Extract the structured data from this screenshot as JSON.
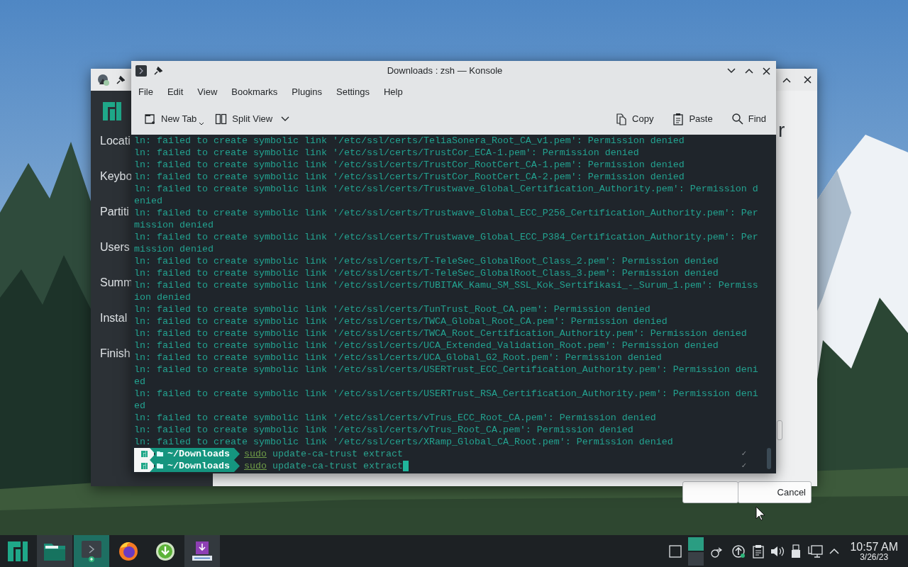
{
  "installer": {
    "sidebar_items": [
      "Locati",
      "Keybo",
      "Partiti",
      "Users",
      "Summ",
      "Instal",
      "Finish"
    ],
    "heading": "r",
    "buttons": [
      "Cancel"
    ]
  },
  "konsole": {
    "title": "Downloads : zsh — Konsole",
    "menu": [
      "File",
      "Edit",
      "View",
      "Bookmarks",
      "Plugins",
      "Settings",
      "Help"
    ],
    "toolbar_left": [
      {
        "kind": "new-tab",
        "label": "New Tab"
      },
      {
        "kind": "split-view",
        "label": "Split View"
      }
    ],
    "toolbar_right": [
      {
        "kind": "copy",
        "label": "Copy"
      },
      {
        "kind": "paste",
        "label": "Paste"
      },
      {
        "kind": "find",
        "label": "Find"
      }
    ],
    "terminal": {
      "lines": [
        "ln: failed to create symbolic link '/etc/ssl/certs/TeliaSonera_Root_CA_v1.pem': Permission denied",
        "ln: failed to create symbolic link '/etc/ssl/certs/TrustCor_ECA-1.pem': Permission denied",
        "ln: failed to create symbolic link '/etc/ssl/certs/TrustCor_RootCert_CA-1.pem': Permission denied",
        "ln: failed to create symbolic link '/etc/ssl/certs/TrustCor_RootCert_CA-2.pem': Permission denied",
        "ln: failed to create symbolic link '/etc/ssl/certs/Trustwave_Global_Certification_Authority.pem': Permission d",
        "enied",
        "ln: failed to create symbolic link '/etc/ssl/certs/Trustwave_Global_ECC_P256_Certification_Authority.pem': Per",
        "mission denied",
        "ln: failed to create symbolic link '/etc/ssl/certs/Trustwave_Global_ECC_P384_Certification_Authority.pem': Per",
        "mission denied",
        "ln: failed to create symbolic link '/etc/ssl/certs/T-TeleSec_GlobalRoot_Class_2.pem': Permission denied",
        "ln: failed to create symbolic link '/etc/ssl/certs/T-TeleSec_GlobalRoot_Class_3.pem': Permission denied",
        "ln: failed to create symbolic link '/etc/ssl/certs/TUBITAK_Kamu_SM_SSL_Kok_Sertifikasi_-_Surum_1.pem': Permiss",
        "ion denied",
        "ln: failed to create symbolic link '/etc/ssl/certs/TunTrust_Root_CA.pem': Permission denied",
        "ln: failed to create symbolic link '/etc/ssl/certs/TWCA_Global_Root_CA.pem': Permission denied",
        "ln: failed to create symbolic link '/etc/ssl/certs/TWCA_Root_Certification_Authority.pem': Permission denied",
        "ln: failed to create symbolic link '/etc/ssl/certs/UCA_Extended_Validation_Root.pem': Permission denied",
        "ln: failed to create symbolic link '/etc/ssl/certs/UCA_Global_G2_Root.pem': Permission denied",
        "ln: failed to create symbolic link '/etc/ssl/certs/USERTrust_ECC_Certification_Authority.pem': Permission deni",
        "ed",
        "ln: failed to create symbolic link '/etc/ssl/certs/USERTrust_RSA_Certification_Authority.pem': Permission deni",
        "ed",
        "ln: failed to create symbolic link '/etc/ssl/certs/vTrus_ECC_Root_CA.pem': Permission denied",
        "ln: failed to create symbolic link '/etc/ssl/certs/vTrus_Root_CA.pem': Permission denied",
        "ln: failed to create symbolic link '/etc/ssl/certs/XRamp_Global_CA_Root.pem': Permission denied"
      ],
      "prompts": [
        {
          "path": "~/Downloads",
          "prefix": "sudo",
          "command": "update-ca-trust extract",
          "status": "✓",
          "cursor": false
        },
        {
          "path": "~/Downloads",
          "prefix": "sudo",
          "command": "update-ca-trust extract",
          "status": "✓",
          "cursor": true
        }
      ]
    }
  },
  "taskbar": {
    "apps": [
      {
        "kind": "menu",
        "selected": false,
        "running": false
      },
      {
        "kind": "files",
        "selected": false,
        "running": true
      },
      {
        "kind": "terminal",
        "selected": true,
        "running": true
      },
      {
        "kind": "browser",
        "selected": false,
        "running": false
      },
      {
        "kind": "downloader",
        "selected": false,
        "running": false
      },
      {
        "kind": "installer",
        "selected": false,
        "running": true
      }
    ],
    "tray": [
      {
        "kind": "show-desktop"
      },
      {
        "kind": "pager"
      },
      {
        "kind": "connect"
      },
      {
        "kind": "updates"
      },
      {
        "kind": "clipboard"
      },
      {
        "kind": "volume"
      },
      {
        "kind": "usb"
      },
      {
        "kind": "network"
      },
      {
        "kind": "expand"
      }
    ],
    "clock": {
      "time": "10:57 AM",
      "date": "3/26/23"
    }
  }
}
